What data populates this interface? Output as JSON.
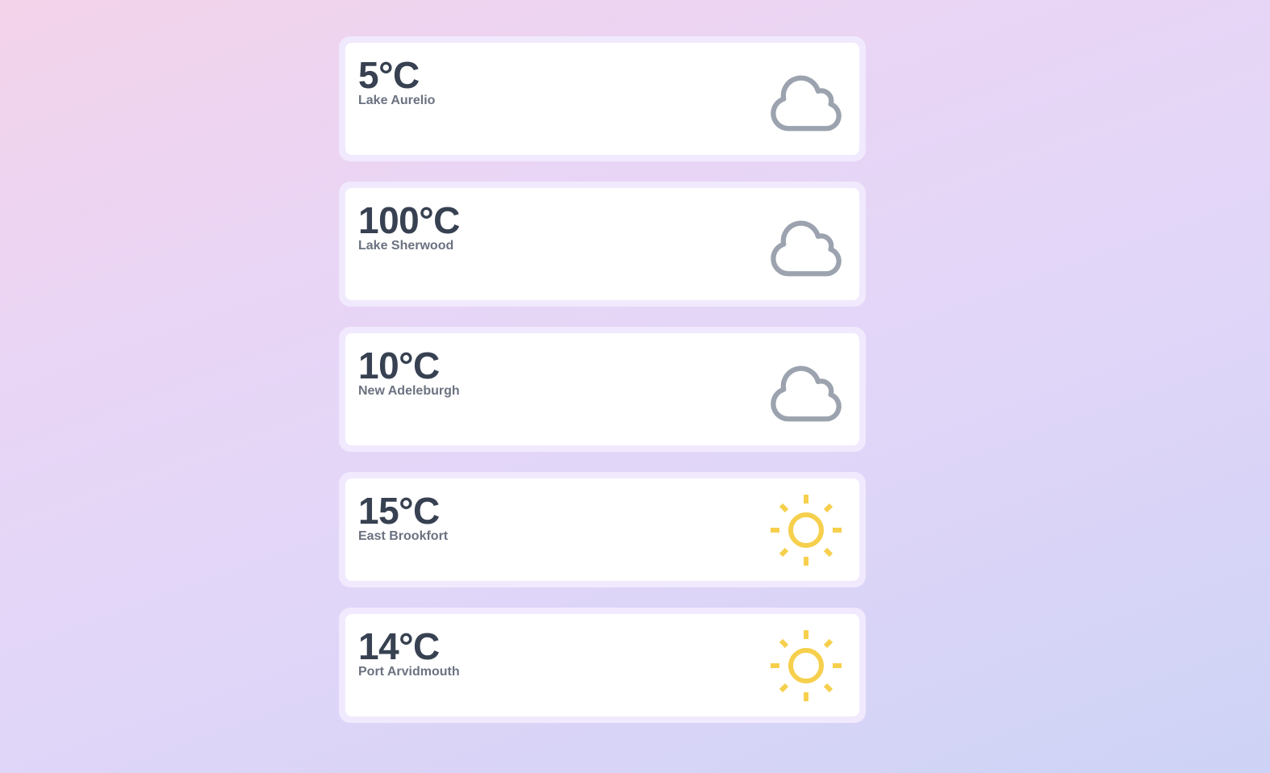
{
  "colors": {
    "temperature_text": "#374151",
    "city_text": "#6b7280",
    "cloud_icon": "#9ca3af",
    "sun_icon": "#f6d04d",
    "card_background": "#ffffff",
    "card_frame": "#f1e9fd"
  },
  "cards": [
    {
      "temperature": "5°C",
      "city": "Lake Aurelio",
      "icon": "cloud-icon"
    },
    {
      "temperature": "100°C",
      "city": "Lake Sherwood",
      "icon": "cloud-icon"
    },
    {
      "temperature": "10°C",
      "city": "New Adeleburgh",
      "icon": "cloud-icon"
    },
    {
      "temperature": "15°C",
      "city": "East Brookfort",
      "icon": "sun-icon"
    },
    {
      "temperature": "14°C",
      "city": "Port Arvidmouth",
      "icon": "sun-icon"
    }
  ]
}
